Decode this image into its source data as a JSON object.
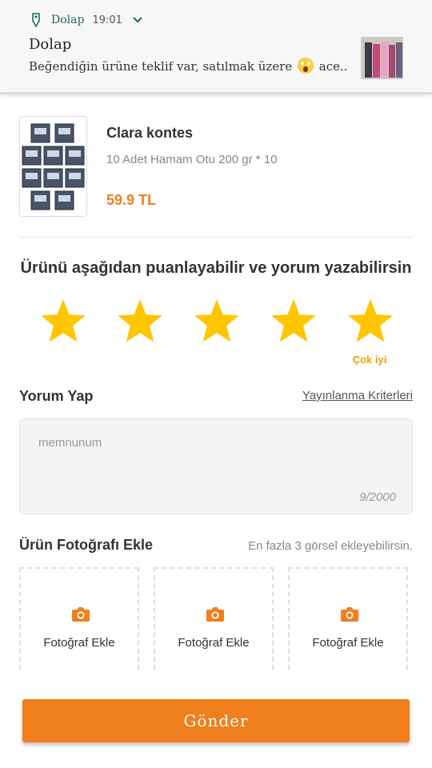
{
  "notification": {
    "app_name": "Dolap",
    "time": "19:01",
    "title": "Dolap",
    "text_before_emoji": "Beğendiğin ürüne teklif var, satılmak üzere",
    "text_after_emoji": "ace..",
    "app_icon": "dolap-hanger-icon",
    "emoji": "face-screaming-in-fear-emoji"
  },
  "product": {
    "name": "Clara kontes",
    "description": "10 Adet Hamam Otu 200 gr * 10",
    "price": "59.9 TL"
  },
  "rating": {
    "title": "Ürünü aşağıdan puanlayabilir ve yorum yazabilirsin",
    "value": 5,
    "max": 5,
    "label": "Çok iyi",
    "star_color": "#ffc600"
  },
  "comment": {
    "title": "Yorum Yap",
    "criteria_link": "Yayınlanma Kriterleri",
    "placeholder": "memnunum",
    "counter": "9/2000"
  },
  "photos": {
    "title": "Ürün Fotoğrafı Ekle",
    "hint": "En fazla 3 görsel ekleyebilirsin.",
    "slots": [
      {
        "label": "Fotoğraf Ekle",
        "icon": "camera-icon"
      },
      {
        "label": "Fotoğraf Ekle",
        "icon": "camera-icon"
      },
      {
        "label": "Fotoğraf Ekle",
        "icon": "camera-icon"
      }
    ]
  },
  "submit": {
    "label": "Gönder"
  },
  "colors": {
    "accent": "#f07f1e",
    "star": "#ffc600",
    "notification_app": "#1d6b53"
  }
}
